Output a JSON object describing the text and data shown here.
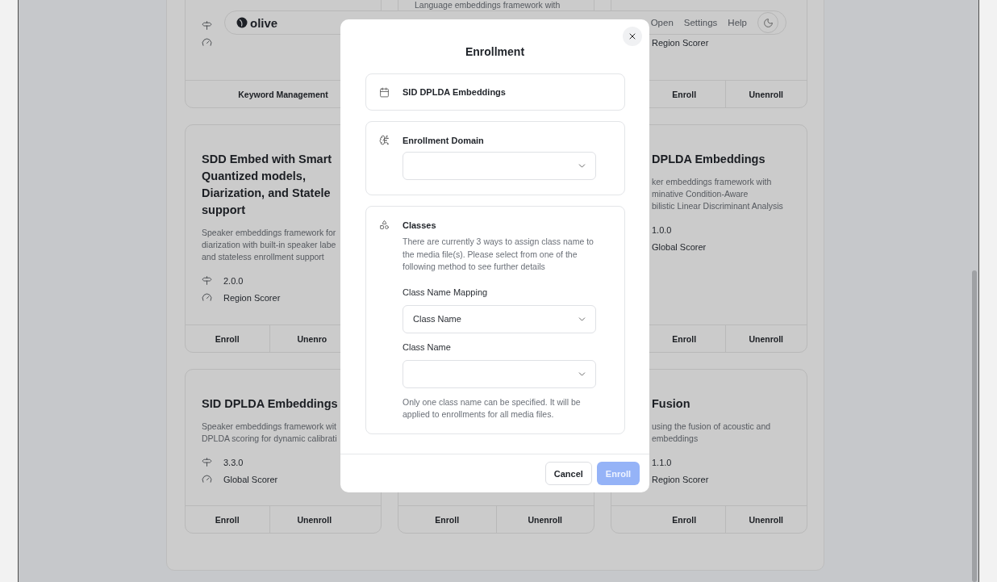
{
  "navbar": {
    "logo": "olive",
    "links": [
      "Open",
      "Settings",
      "Help"
    ]
  },
  "card_rows": [
    [
      {
        "meta": [
          {
            "kind": "version"
          },
          {
            "kind": "scorer"
          }
        ],
        "actions": [
          "Keyword Management"
        ]
      },
      {
        "description": "Language embeddings framework with"
      },
      {
        "meta": [
          {
            "kind": "scorer",
            "text": "Region Scorer"
          }
        ],
        "actions": [
          "Enroll",
          "Unenroll"
        ]
      }
    ],
    [
      {
        "title": "SDD Embed with Smart\nQuantized models,\nDiarization, and Statele\nsupport",
        "description": "Speaker embeddings framework for\ndiarization with built-in speaker labe\nand stateless enrollment support",
        "meta": [
          {
            "kind": "version",
            "text": "2.0.0"
          },
          {
            "kind": "scorer",
            "text": "Region Scorer"
          }
        ],
        "actions": [
          "Enroll",
          "Unenro"
        ]
      },
      {
        "title": "DPLDA Embeddings",
        "description": "ker embeddings framework with\nminative Condition-Aware\nbilistic Linear Discriminant Analysis",
        "meta": [
          {
            "kind": "version",
            "text": "1.0.0"
          },
          {
            "kind": "scorer",
            "text": "Global Scorer"
          }
        ],
        "actions": [
          "Enroll",
          "Unenroll"
        ]
      }
    ],
    [
      {
        "title": "SID DPLDA Embeddings",
        "description": "Speaker embeddings framework wit\nDPLDA scoring for dynamic calibrati",
        "meta": [
          {
            "kind": "version",
            "text": "3.3.0"
          },
          {
            "kind": "scorer",
            "text": "Global Scorer"
          }
        ],
        "actions": [
          "Enroll",
          "Unenroll"
        ]
      },
      {
        "actions": [
          "Enroll",
          "Unenroll"
        ]
      },
      {
        "title": "Fusion",
        "description": "using the fusion of acoustic and\nembeddings",
        "meta": [
          {
            "kind": "version",
            "text": "1.1.0"
          },
          {
            "kind": "scorer",
            "text": "Region Scorer"
          }
        ],
        "actions": [
          "Enroll",
          "Unenroll"
        ]
      }
    ]
  ],
  "modal": {
    "title": "Enrollment",
    "plugin": "SID DPLDA Embeddings",
    "sections": [
      {
        "kind": "domain",
        "label": "Enrollment Domain"
      },
      {
        "kind": "classes",
        "label": "Classes",
        "description": "There are currently 3 ways to assign class name to the media file(s). Please select from one of the following method to see further details",
        "fields": [
          {
            "label": "Class Name Mapping",
            "value": "Class Name"
          },
          {
            "label": "Class Name"
          }
        ],
        "hint": "Only one class name can be specified. It will be applied to enrollments for all media files."
      }
    ],
    "buttons": [
      {
        "label": "Cancel",
        "kind": "secondary",
        "disabled": false
      },
      {
        "label": "Enroll",
        "kind": "primary",
        "disabled": true
      }
    ]
  }
}
